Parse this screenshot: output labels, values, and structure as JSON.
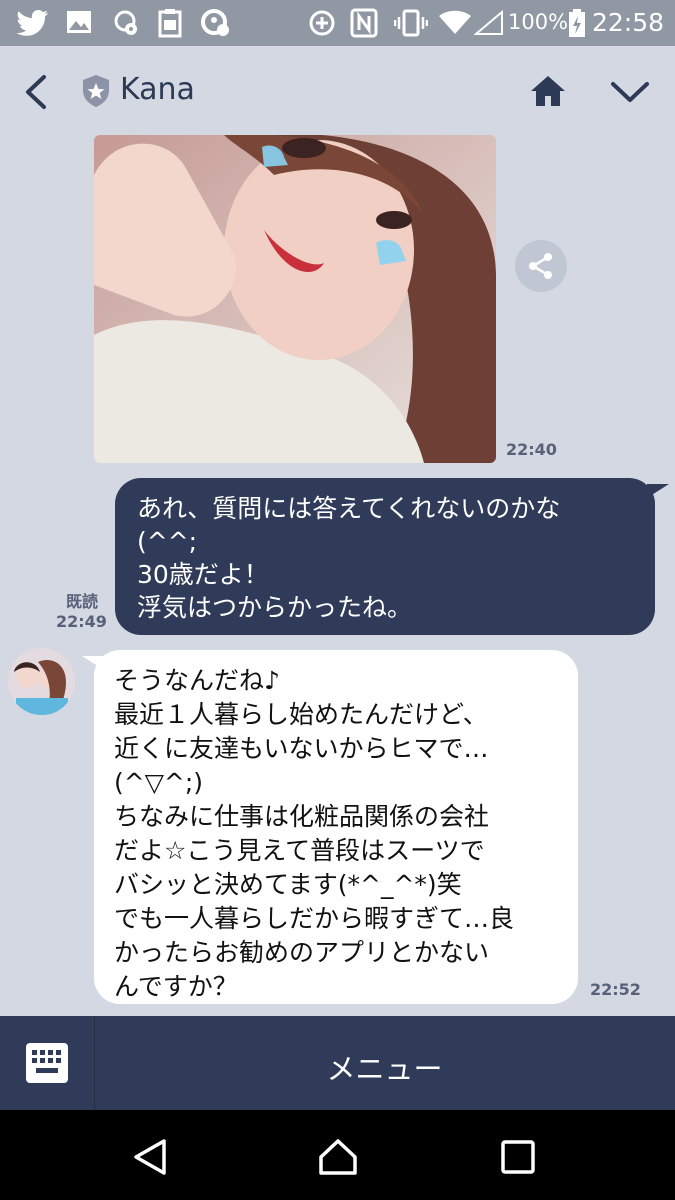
{
  "status_bar": {
    "battery_percent": "100%",
    "time": "22:58",
    "icons": [
      "twitter-icon",
      "gallery-icon",
      "cloud-gear-icon",
      "clipboard-icon",
      "sync-gear-icon",
      "data-saver-icon",
      "nfc-icon",
      "vibrate-icon",
      "wifi-icon",
      "signal-icon",
      "battery-charging-icon"
    ]
  },
  "header": {
    "contact_name": "Kana",
    "icons": [
      "back-icon",
      "shield-star-icon",
      "home-icon",
      "chevron-down-icon"
    ]
  },
  "messages": [
    {
      "type": "image",
      "direction": "incoming",
      "time": "22:40"
    },
    {
      "type": "text",
      "direction": "outgoing",
      "lines": [
        "あれ、質問には答えてくれないのかな",
        "(^^;",
        "30歳だよ！",
        "浮気はつからかったね。"
      ],
      "read_label": "既読",
      "time": "22:49"
    },
    {
      "type": "text",
      "direction": "incoming",
      "lines": [
        "そうなんだね♪",
        "最近１人暮らし始めたんだけど、",
        "近くに友達もいないからヒマで…",
        "(^▽^;)",
        "ちなみに仕事は化粧品関係の会社",
        "だよ☆こう見えて普段はスーツで",
        "バシッと決めてます(*^_^*)笑",
        "でも一人暮らしだから暇すぎて…良",
        "かったらお勧めのアプリとかない",
        "んですか？"
      ],
      "time": "22:52"
    }
  ],
  "menu": {
    "label": "メニュー",
    "icon": "keyboard-icon"
  },
  "navigation": {
    "icons": [
      "back-triangle-icon",
      "home-nav-icon",
      "recents-icon"
    ]
  },
  "colors": {
    "background": "#d3d8e2",
    "outgoing_bubble": "#2f3b58",
    "incoming_bubble": "#ffffff",
    "status_bar": "#9098a4"
  }
}
